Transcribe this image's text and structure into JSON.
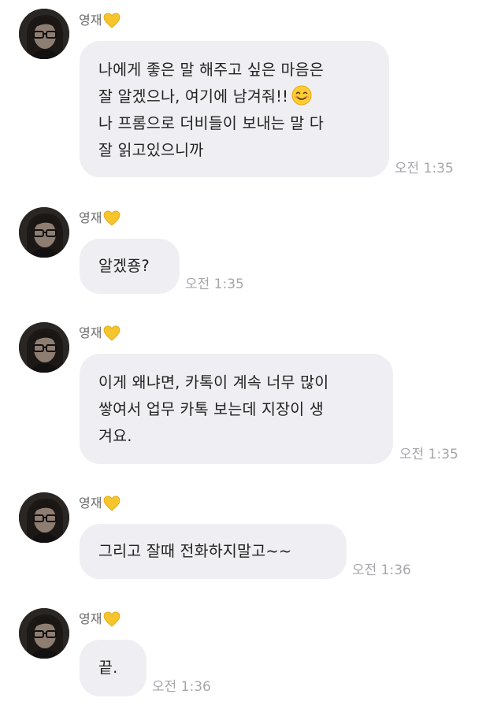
{
  "messages": [
    {
      "sender": "영재",
      "sender_badge": "yellow-heart-icon",
      "lines": [
        "나에게 좋은 말 해주고 싶은 마음은",
        "잘 알겠으나, 여기에 남겨줘!!",
        "나 프롬으로 더비들이 보내는 말 다",
        "잘 읽고있으니까"
      ],
      "emoji": "smiling-face-icon",
      "time": "오전 1:35"
    },
    {
      "sender": "영재",
      "sender_badge": "yellow-heart-icon",
      "lines": [
        "알겠죵?"
      ],
      "time": "오전 1:35"
    },
    {
      "sender": "영재",
      "sender_badge": "yellow-heart-icon",
      "lines": [
        "이게 왜냐면, 카톡이 계속 너무 많이",
        "쌓여서 업무 카톡 보는데 지장이 생",
        "겨요."
      ],
      "time": "오전 1:35"
    },
    {
      "sender": "영재",
      "sender_badge": "yellow-heart-icon",
      "lines": [
        "그리고 잘때 전화하지말고~~"
      ],
      "time": "오전 1:36"
    },
    {
      "sender": "영재",
      "sender_badge": "yellow-heart-icon",
      "lines": [
        "끝."
      ],
      "time": "오전 1:36"
    }
  ],
  "colors": {
    "bubble": "#efeff3",
    "time": "#a6a6ab",
    "sender": "#6a6a6a",
    "heart": "#f6c52b"
  }
}
